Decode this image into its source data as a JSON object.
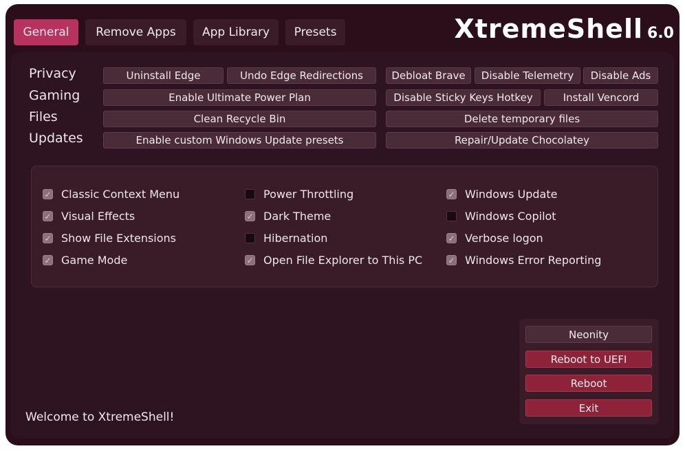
{
  "tabs": [
    {
      "label": "General",
      "active": true
    },
    {
      "label": "Remove Apps",
      "active": false
    },
    {
      "label": "App Library",
      "active": false
    },
    {
      "label": "Presets",
      "active": false
    }
  ],
  "brand": {
    "name": "XtremeShell",
    "version": "6.0"
  },
  "rows": {
    "privacy": "Privacy",
    "gaming": "Gaming",
    "files": "Files",
    "updates": "Updates"
  },
  "buttons": {
    "uninstall_edge": "Uninstall Edge",
    "undo_edge_redirections": "Undo Edge Redirections",
    "debloat_brave": "Debloat Brave",
    "disable_telemetry": "Disable Telemetry",
    "disable_ads": "Disable Ads",
    "enable_ultimate_power_plan": "Enable Ultimate Power Plan",
    "disable_sticky_keys_hotkey": "Disable Sticky Keys Hotkey",
    "install_vencord": "Install Vencord",
    "clean_recycle_bin": "Clean Recycle Bin",
    "delete_temporary_files": "Delete temporary files",
    "enable_custom_wu_presets": "Enable custom Windows Update presets",
    "repair_update_chocolatey": "Repair/Update Chocolatey"
  },
  "options": [
    {
      "label": "Classic Context Menu",
      "checked": true
    },
    {
      "label": "Visual Effects",
      "checked": true
    },
    {
      "label": "Show File Extensions",
      "checked": true
    },
    {
      "label": "Game Mode",
      "checked": true
    },
    {
      "label": "Power Throttling",
      "checked": false
    },
    {
      "label": "Dark Theme",
      "checked": true
    },
    {
      "label": "Hibernation",
      "checked": false
    },
    {
      "label": "Open File Explorer to This PC",
      "checked": true
    },
    {
      "label": "Windows Update",
      "checked": true
    },
    {
      "label": "Windows Copilot",
      "checked": false
    },
    {
      "label": "Verbose logon",
      "checked": true
    },
    {
      "label": "Windows Error Reporting",
      "checked": true
    }
  ],
  "status": {
    "welcome": "Welcome to XtremeShell!"
  },
  "side_buttons": {
    "neonity": "Neonity",
    "reboot_uefi": "Reboot to UEFI",
    "reboot": "Reboot",
    "exit": "Exit"
  },
  "colors": {
    "accent": "#b8325f",
    "danger": "#8d2238",
    "background": "#2a0f1a"
  }
}
